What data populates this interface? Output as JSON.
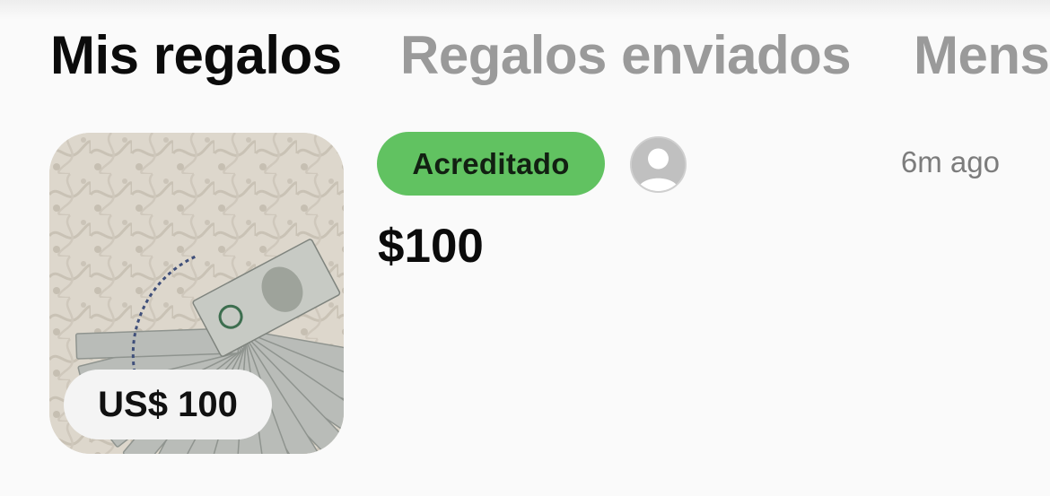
{
  "tabs": [
    {
      "label": "Mis regalos",
      "active": true
    },
    {
      "label": "Regalos enviados",
      "active": false
    },
    {
      "label": "Mens",
      "active": false
    }
  ],
  "gift": {
    "thumbnail_price": "US$ 100",
    "status": "Acreditado",
    "time": "6m ago",
    "amount": "$100",
    "avatar_icon": "person-placeholder-icon"
  },
  "colors": {
    "status_green": "#61c261",
    "active_tab": "#0b0b0b",
    "inactive_tab": "#9a9a9a"
  }
}
